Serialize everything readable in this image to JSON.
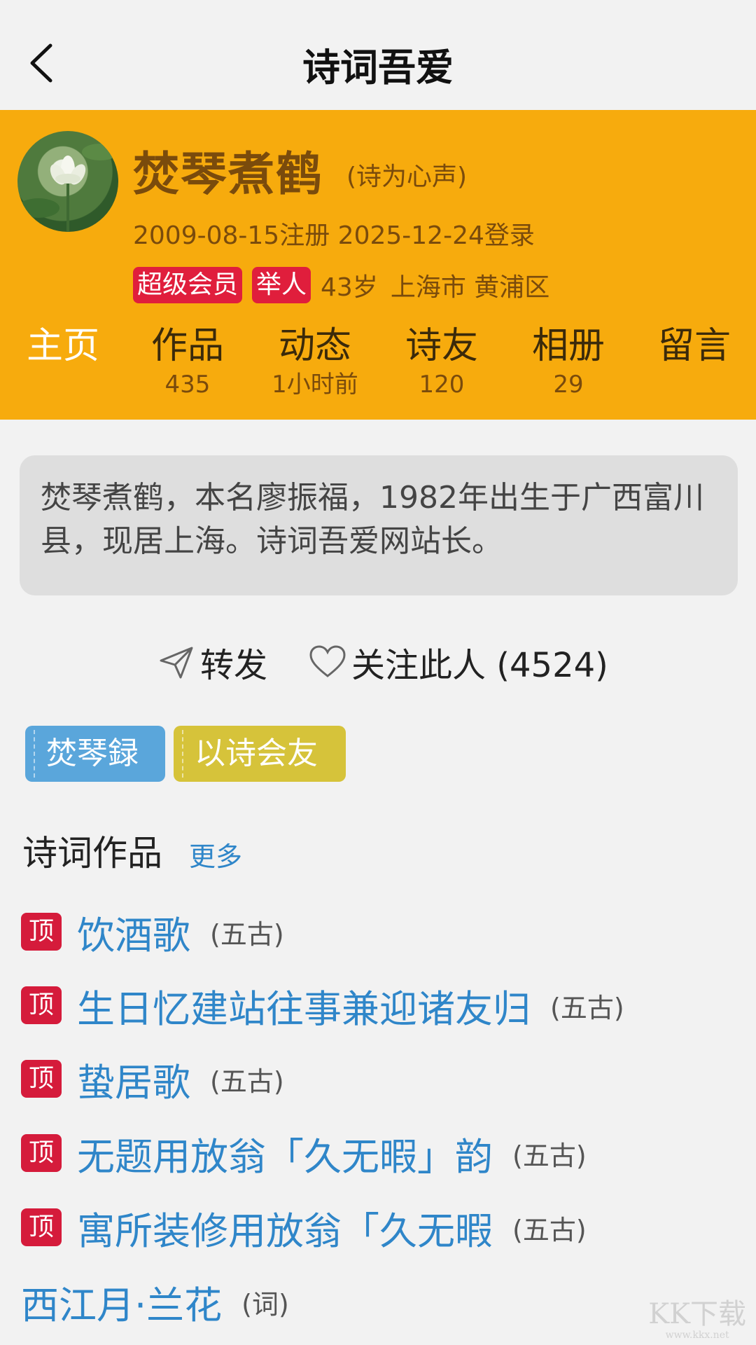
{
  "topbar": {
    "title": "诗词吾爱"
  },
  "profile": {
    "name": "焚琴煮鹤",
    "motto": "(诗为心声)",
    "reg_line": "2009-08-15注册  2025-12-24登录",
    "badges": [
      "超级会员",
      "举人"
    ],
    "age": "43岁",
    "location": "上海市 黄浦区"
  },
  "tabs": [
    {
      "label": "主页",
      "count": ""
    },
    {
      "label": "作品",
      "count": "435"
    },
    {
      "label": "动态",
      "count": "1小时前"
    },
    {
      "label": "诗友",
      "count": "120"
    },
    {
      "label": "相册",
      "count": "29"
    },
    {
      "label": "留言",
      "count": ""
    }
  ],
  "bio": "焚琴煮鹤，本名廖振福，1982年出生于广西富川县，现居上海。诗词吾爱网站长。",
  "actions": {
    "share": "转发",
    "follow": "关注此人 (4524)"
  },
  "tags": [
    "焚琴録",
    "以诗会友"
  ],
  "works": {
    "section_title": "诗词作品",
    "more": "更多",
    "pin_label": "顶",
    "items": [
      {
        "title": "饮酒歌",
        "type": "(五古)",
        "pinned": true
      },
      {
        "title": "生日忆建站往事兼迎诸友归",
        "type": "(五古)",
        "pinned": true
      },
      {
        "title": "蛰居歌",
        "type": "(五古)",
        "pinned": true
      },
      {
        "title": "无题用放翁「久无暇」韵",
        "type": "(五古)",
        "pinned": true
      },
      {
        "title": "寓所装修用放翁「久无暇",
        "type": "(五古)",
        "pinned": true
      },
      {
        "title": "西江月·兰花",
        "type": "(词)",
        "pinned": false
      }
    ]
  },
  "watermark": {
    "big": "KK下载",
    "small": "www.kkx.net"
  },
  "colors": {
    "header_bg": "#f7ab0d",
    "badge_red": "#e01e3c",
    "link_blue": "#2f86c9",
    "tag_blue": "#5aa6db",
    "tag_yellow": "#d6c33a"
  }
}
